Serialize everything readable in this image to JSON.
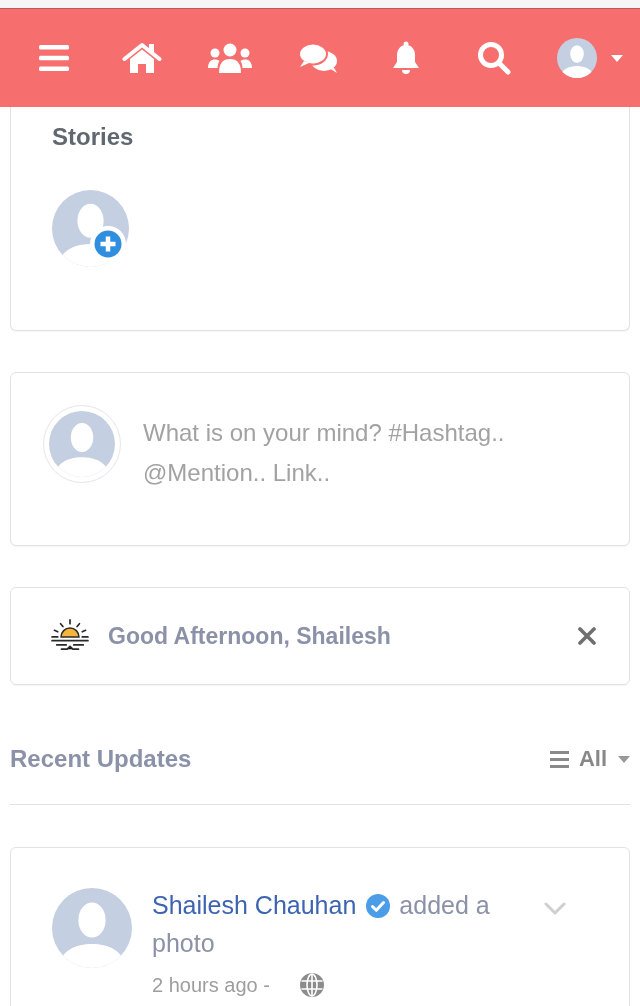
{
  "stories": {
    "title": "Stories"
  },
  "composer": {
    "placeholder": "What is on your mind? #Hashtag.. @Mention.. Link.."
  },
  "greeting": {
    "text": "Good Afternoon, Shailesh"
  },
  "updates": {
    "title": "Recent Updates",
    "filter": "All"
  },
  "posts": [
    {
      "author": "Shailesh Chauhan",
      "verified": true,
      "action": "added a photo",
      "time": "2 hours ago -"
    }
  ]
}
